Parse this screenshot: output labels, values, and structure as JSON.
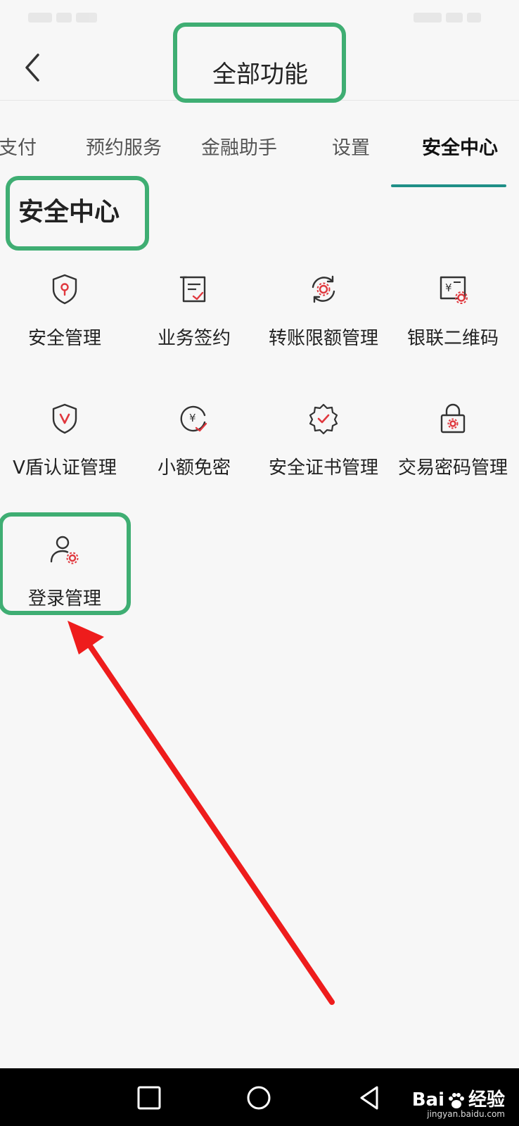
{
  "header": {
    "title": "全部功能"
  },
  "tabs": [
    {
      "label": "支付"
    },
    {
      "label": "预约服务"
    },
    {
      "label": "金融助手"
    },
    {
      "label": "设置"
    },
    {
      "label": "安全中心"
    }
  ],
  "section": {
    "title": "安全中心"
  },
  "grid": [
    {
      "label": "安全管理",
      "icon": "shield-key-icon"
    },
    {
      "label": "业务签约",
      "icon": "contract-check-icon"
    },
    {
      "label": "转账限额管理",
      "icon": "transfer-limit-gear-icon"
    },
    {
      "label": "银联二维码",
      "icon": "unionpay-qr-icon"
    },
    {
      "label": "V盾认证管理",
      "icon": "v-shield-icon"
    },
    {
      "label": "小额免密",
      "icon": "yen-check-icon"
    },
    {
      "label": "安全证书管理",
      "icon": "certificate-gear-icon"
    },
    {
      "label": "交易密码管理",
      "icon": "lock-gear-icon"
    },
    {
      "label": "登录管理",
      "icon": "user-gear-icon"
    }
  ],
  "colors": {
    "accent": "#1f8f87",
    "icon_stroke": "#333333",
    "icon_highlight": "#e0383e",
    "annotation_box": "#3fae73",
    "annotation_arrow": "#ee1c1c"
  },
  "watermark": {
    "text_left": "Bai",
    "text_right": "经验",
    "subtext": "jingyan.baidu.com"
  }
}
